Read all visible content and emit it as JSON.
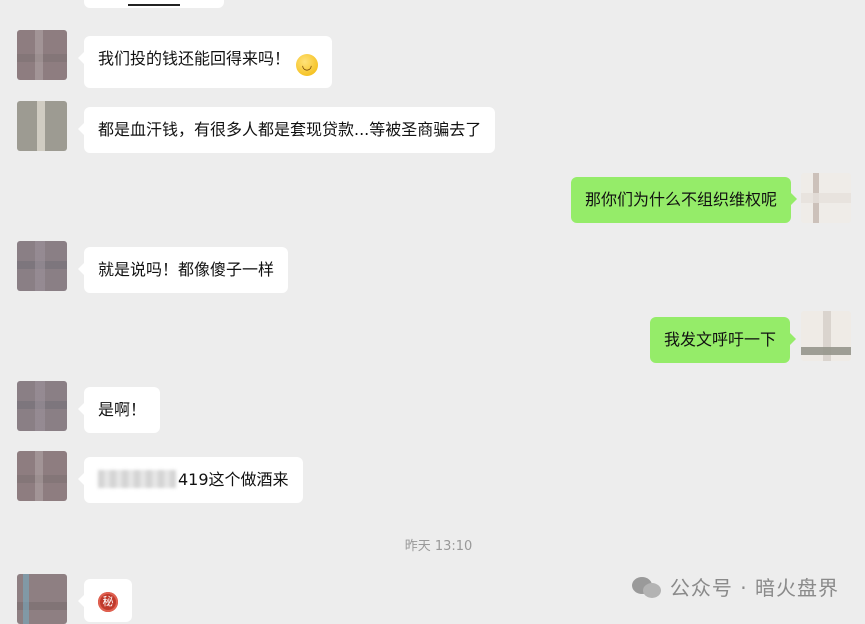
{
  "messages": [
    {
      "side": "left",
      "text": "我们投的钱还能回得来吗！",
      "emoji": "😂"
    },
    {
      "side": "left",
      "text": "都是血汗钱，有很多人都是套现贷款...等被圣商骗去了"
    },
    {
      "side": "right",
      "text": "那你们为什么不组织维权呢"
    },
    {
      "side": "left",
      "text": "就是说吗！都像傻子一样"
    },
    {
      "side": "right",
      "text": "我发文呼吁一下"
    },
    {
      "side": "left",
      "text": "是啊！"
    },
    {
      "side": "left",
      "text": "419这个做酒来"
    },
    {
      "side": "left",
      "sticker": "秘"
    }
  ],
  "timestamp": "昨天 13:10",
  "watermark": {
    "text": "公众号 · 暗火盘界",
    "icon": "wechat-icon"
  }
}
